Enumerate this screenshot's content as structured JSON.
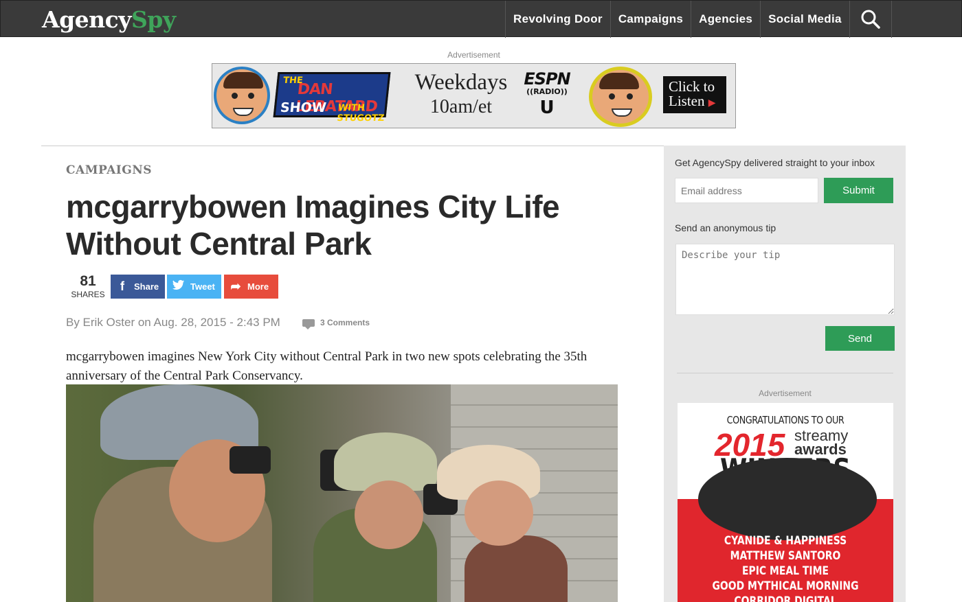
{
  "header": {
    "logo_part1": "Agency",
    "logo_part2": "Spy",
    "nav": [
      "Revolving Door",
      "Campaigns",
      "Agencies",
      "Social Media"
    ],
    "search_icon": "search-icon"
  },
  "top_ad": {
    "label": "Advertisement",
    "show_line1": "THE",
    "show_line2": "DAN LEBATARD",
    "show_line3": "SHOW",
    "show_line4": "WITH STUGOTZ",
    "schedule_line1": "Weekdays",
    "schedule_line2": "10am/et",
    "espn_line1": "ESPN",
    "espn_line2": "((RADIO))",
    "espn_line3": "U",
    "cta_line1": "Click to",
    "cta_line2": "Listen",
    "cta_arrow": "▶"
  },
  "article": {
    "kicker": "CAMPAIGNS",
    "title": "mcgarrybowen Imagines City Life Without Central Park",
    "shares_count": "81",
    "shares_label": "SHARES",
    "share_buttons": [
      {
        "label": "Share",
        "icon": "f"
      },
      {
        "label": "Tweet",
        "icon": "t"
      },
      {
        "label": "More",
        "icon": "➦"
      }
    ],
    "byline": "By Erik Oster on Aug. 28, 2015 - 2:43 PM",
    "comments": "3 Comments",
    "lede": "mcgarrybowen imagines New York City without Central Park in two new spots celebrating the 35th anniversary of the Central Park Conservancy."
  },
  "sidebar": {
    "newsletter_label": "Get AgencySpy delivered straight to your inbox",
    "email_placeholder": "Email address",
    "submit_label": "Submit",
    "tip_label": "Send an anonymous tip",
    "tip_placeholder": "Describe your tip",
    "send_label": "Send",
    "ad_label": "Advertisement",
    "ad": {
      "congrats": "CONGRATULATIONS TO OUR",
      "year": "2015",
      "brand_line1": "streamy",
      "brand_line2": "awards",
      "winners": "WINNERS",
      "list": [
        "CYANIDE & HAPPINESS",
        "MATTHEW SANTORO",
        "EPIC MEAL TIME",
        "GOOD MYTHICAL MORNING",
        "CORRIDOR DIGITAL"
      ]
    }
  }
}
